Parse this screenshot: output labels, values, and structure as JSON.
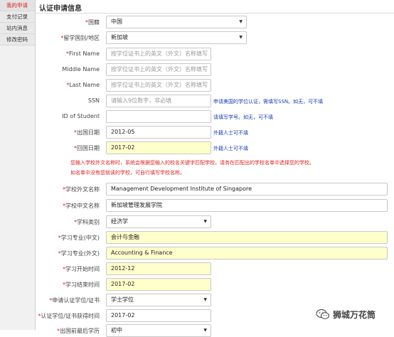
{
  "sidebar": {
    "items": [
      {
        "label": "我的申请"
      },
      {
        "label": "支付记录"
      },
      {
        "label": "站内消息"
      },
      {
        "label": "修改密码"
      }
    ]
  },
  "main": {
    "title": "认证申请信息",
    "note_line1": "您输入学校外文名称时，系统会根据您输入的校名关键字匹配学校，请务在匹配出的学校名单中选择您的学校。",
    "note_line2": "如名单中没有您就读的学校，可自行填写学校名称。"
  },
  "form": {
    "nationality": {
      "label": "国籍",
      "value": "中国"
    },
    "study_country": {
      "label": "留学国别/地区",
      "value": "新加坡"
    },
    "first_name": {
      "label": "First Name",
      "placeholder": "按学位证书上的英文（外文）名称填写"
    },
    "middle_name": {
      "label": "Middle Name",
      "placeholder": "按学位证书上的英文（外文）名称填写"
    },
    "last_name": {
      "label": "Last Name",
      "placeholder": "按学位证书上的英文（外文）名称填写"
    },
    "ssn": {
      "label": "SSN",
      "placeholder": "请输入9位数字，非必填",
      "hint": "申请美国的学位认证，需填写SSN。如无，可不填"
    },
    "student_id": {
      "label": "ID of Student",
      "value": "",
      "hint": "请填写学号。如无，可不填"
    },
    "exit_date": {
      "label": "出国日期",
      "value": "2012-05",
      "hint": "外籍人士可不填"
    },
    "return_date": {
      "label": "回国日期",
      "value": "2017-02",
      "hint": "外籍人士可不填"
    },
    "school_foreign": {
      "label": "学校外文名称",
      "value": "Management Development Institute of Singapore"
    },
    "school_chinese": {
      "label": "学校中文名称",
      "value": "新加坡管理发展学院"
    },
    "subject": {
      "label": "学科类别",
      "value": "经济学"
    },
    "major_cn": {
      "label": "学习专业(中文)",
      "value": "会计与金融"
    },
    "major_foreign": {
      "label": "学习专业(外文)",
      "value": "Accounting & Finance"
    },
    "study_start": {
      "label": "学习开始时间",
      "value": "2012-12"
    },
    "study_end": {
      "label": "学习结束时间",
      "value": "2017-02"
    },
    "degree": {
      "label": "申请认证学位/证书",
      "value": "学士学位"
    },
    "degree_date": {
      "label": "认证学位/证书获得时间",
      "value": "2017-02"
    },
    "prior_edu": {
      "label": "出国前最后学历",
      "value": "初中"
    }
  },
  "watermark": {
    "text": "狮城万花筒"
  }
}
